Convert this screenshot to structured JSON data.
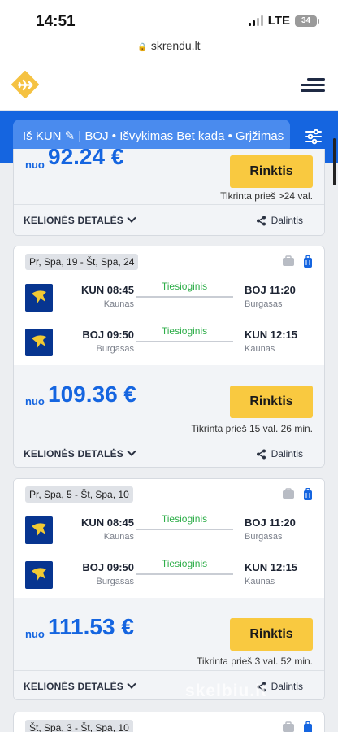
{
  "status": {
    "time": "14:51",
    "network": "LTE",
    "battery": "34"
  },
  "browser": {
    "url": "skrendu.lt"
  },
  "search": {
    "summary": "Iš KUN ✎ | BOJ • Išvykimas Bet kada • Grįžimas"
  },
  "labels": {
    "from": "nuo",
    "select": "Rinktis",
    "details": "KELIONĖS DETALĖS",
    "share": "Dalintis",
    "direct": "Tiesioginis"
  },
  "cards": [
    {
      "price": "92.24 €",
      "checked": "Tikrinta prieš >24 val."
    },
    {
      "dates": "Pr, Spa, 19 - Št, Spa, 24",
      "outbound": {
        "dep_time": "KUN 08:45",
        "dep_city": "Kaunas",
        "arr_time": "BOJ 11:20",
        "arr_city": "Burgasas"
      },
      "inbound": {
        "dep_time": "BOJ 09:50",
        "dep_city": "Burgasas",
        "arr_time": "KUN 12:15",
        "arr_city": "Kaunas"
      },
      "price": "109.36 €",
      "checked": "Tikrinta prieš 15 val. 26 min."
    },
    {
      "dates": "Pr, Spa, 5 - Št, Spa, 10",
      "outbound": {
        "dep_time": "KUN 08:45",
        "dep_city": "Kaunas",
        "arr_time": "BOJ 11:20",
        "arr_city": "Burgasas"
      },
      "inbound": {
        "dep_time": "BOJ 09:50",
        "dep_city": "Burgasas",
        "arr_time": "KUN 12:15",
        "arr_city": "Kaunas"
      },
      "price": "111.53 €",
      "checked": "Tikrinta prieš 3 val. 52 min."
    },
    {
      "dates": "Št, Spa, 3 - Št, Spa, 10"
    }
  ],
  "watermark": "skelbiu.lt",
  "colors": {
    "brand_blue": "#1565e0",
    "accent_yellow": "#f9c940",
    "direct_green": "#2fae4a",
    "ryanair_navy": "#073590"
  },
  "icons": [
    "lock-icon",
    "plane-logo-icon",
    "menu-icon",
    "filter-icon",
    "cabin-bag-icon",
    "luggage-icon",
    "ryanair-logo-icon",
    "share-icon",
    "chevron-down-icon"
  ]
}
